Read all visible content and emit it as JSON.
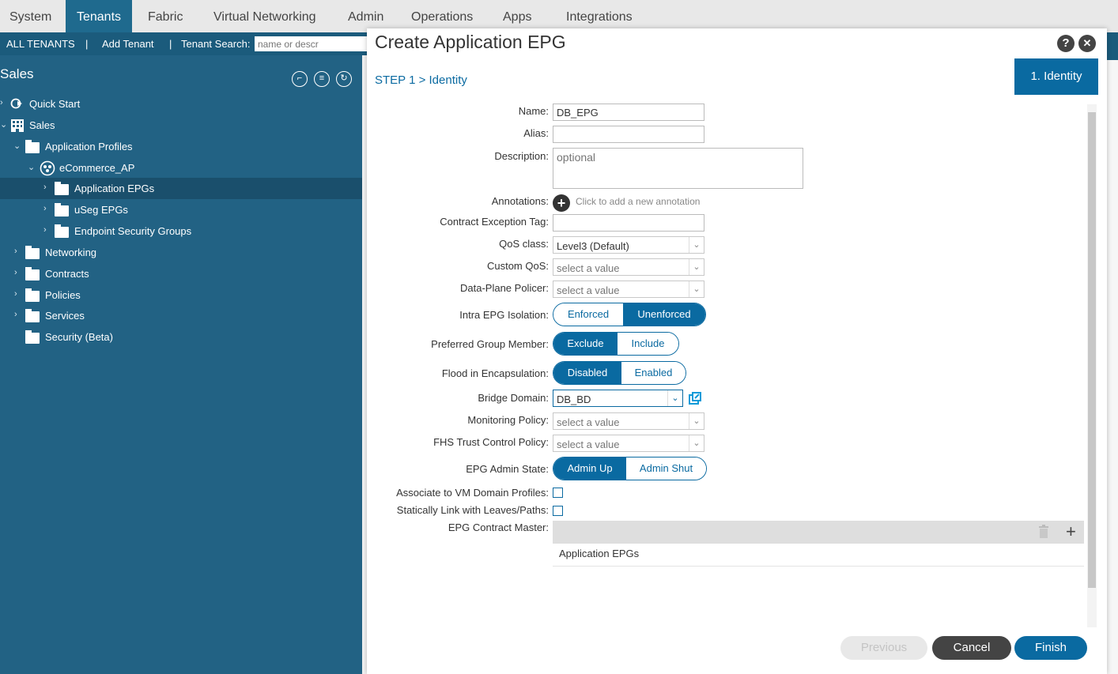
{
  "topnav": {
    "tabs": [
      "System",
      "Tenants",
      "Fabric",
      "Virtual Networking",
      "Admin",
      "Operations",
      "Apps",
      "Integrations"
    ],
    "active": "Tenants"
  },
  "subbar": {
    "all_tenants": "ALL TENANTS",
    "sep": "|",
    "add_tenant": "Add Tenant",
    "tenant_search_label": "Tenant Search:",
    "tenant_search_placeholder": "name or descr"
  },
  "sidebar": {
    "title": "Sales",
    "tree": [
      {
        "label": "Quick Start",
        "icon": "quick-start-icon"
      },
      {
        "label": "Sales",
        "icon": "tenant-grid-icon"
      },
      {
        "label": "Application Profiles",
        "icon": "folder-icon"
      },
      {
        "label": "eCommerce_AP",
        "icon": "app-profile-icon"
      },
      {
        "label": "Application EPGs",
        "icon": "folder-icon",
        "selected": true
      },
      {
        "label": "uSeg EPGs",
        "icon": "folder-icon"
      },
      {
        "label": "Endpoint Security Groups",
        "icon": "folder-icon"
      },
      {
        "label": "Networking",
        "icon": "folder-icon"
      },
      {
        "label": "Contracts",
        "icon": "folder-icon"
      },
      {
        "label": "Policies",
        "icon": "folder-icon"
      },
      {
        "label": "Services",
        "icon": "folder-icon"
      },
      {
        "label": "Security (Beta)",
        "icon": "folder-icon"
      }
    ]
  },
  "dialog": {
    "title": "Create Application EPG",
    "help_icon": "?",
    "close_icon": "✕",
    "step_box": "1. Identity",
    "step_label": "STEP 1 > Identity",
    "fields": {
      "name_label": "Name:",
      "name_value": "DB_EPG",
      "alias_label": "Alias:",
      "alias_value": "",
      "description_label": "Description:",
      "description_placeholder": "optional",
      "annotations_label": "Annotations:",
      "annotations_hint": "Click to add a new annotation",
      "contract_exception_label": "Contract Exception Tag:",
      "qos_label": "QoS class:",
      "qos_value": "Level3 (Default)",
      "custom_qos_label": "Custom QoS:",
      "custom_qos_value": "select a value",
      "policer_label": "Data-Plane Policer:",
      "policer_value": "select a value",
      "isolation_label": "Intra EPG Isolation:",
      "isolation_options": [
        "Enforced",
        "Unenforced"
      ],
      "isolation_selected": "Unenforced",
      "preferred_label": "Preferred Group Member:",
      "preferred_options": [
        "Exclude",
        "Include"
      ],
      "preferred_selected": "Exclude",
      "flood_label": "Flood in Encapsulation:",
      "flood_options": [
        "Disabled",
        "Enabled"
      ],
      "flood_selected": "Disabled",
      "bd_label": "Bridge Domain:",
      "bd_value": "DB_BD",
      "monitoring_label": "Monitoring Policy:",
      "monitoring_value": "select a value",
      "fhs_label": "FHS Trust Control Policy:",
      "fhs_value": "select a value",
      "admin_state_label": "EPG Admin State:",
      "admin_state_options": [
        "Admin Up",
        "Admin Shut"
      ],
      "admin_state_selected": "Admin Up",
      "vm_domain_label": "Associate to VM Domain Profiles:",
      "vm_domain_checked": false,
      "static_link_label": "Statically Link with Leaves/Paths:",
      "static_link_checked": false,
      "contract_master_label": "EPG Contract Master:",
      "contract_master_header": "Application EPGs"
    },
    "buttons": {
      "previous": "Previous",
      "cancel": "Cancel",
      "finish": "Finish"
    }
  },
  "colors": {
    "primary": "#0a6aa1",
    "sidebar": "#226284",
    "cancel": "#444444"
  }
}
